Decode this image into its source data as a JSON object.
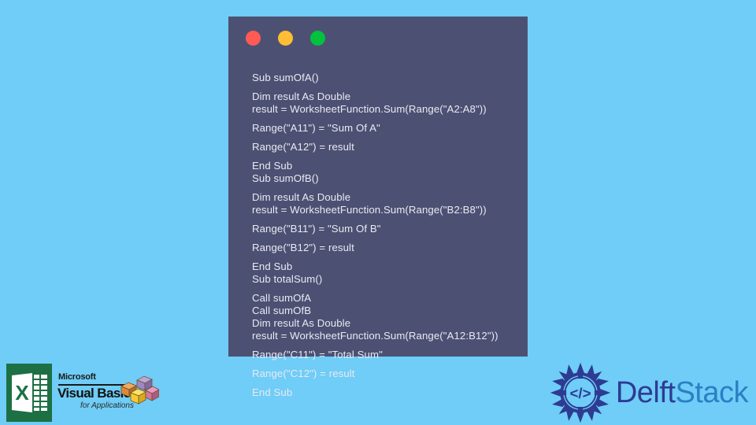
{
  "theme": {
    "page_background": "#6FCDF7",
    "code_panel_background": "#4C5173",
    "code_text_color": "#E9E9F2",
    "traffic_close": "#FF5A54",
    "traffic_minimize": "#FFBE33",
    "traffic_maximize": "#02C23E",
    "delft_color": "#2E3B92",
    "stack_color": "#2B7FC4",
    "excel_green": "#1D7044"
  },
  "window": {
    "controls": [
      {
        "name": "close",
        "color": "#FF5A54"
      },
      {
        "name": "minimize",
        "color": "#FFBE33"
      },
      {
        "name": "maximize",
        "color": "#02C23E"
      }
    ]
  },
  "code": {
    "language": "VBA",
    "lines": [
      {
        "text": "Sub sumOfA()",
        "gap_above": true
      },
      {
        "text": "Dim result As Double",
        "gap_above": true
      },
      {
        "text": "result = WorksheetFunction.Sum(Range(\"A2:A8\"))",
        "gap_above": false
      },
      {
        "text": "Range(\"A11\") = \"Sum Of A\"",
        "gap_above": true
      },
      {
        "text": "Range(\"A12\") = result",
        "gap_above": true
      },
      {
        "text": "End Sub",
        "gap_above": true
      },
      {
        "text": "Sub sumOfB()",
        "gap_above": false
      },
      {
        "text": "Dim result As Double",
        "gap_above": true
      },
      {
        "text": "result = WorksheetFunction.Sum(Range(\"B2:B8\"))",
        "gap_above": false
      },
      {
        "text": "Range(\"B11\") = \"Sum Of B\"",
        "gap_above": true
      },
      {
        "text": "Range(\"B12\") = result",
        "gap_above": true
      },
      {
        "text": "End Sub",
        "gap_above": true
      },
      {
        "text": "Sub totalSum()",
        "gap_above": false
      },
      {
        "text": "Call sumOfA",
        "gap_above": true
      },
      {
        "text": "Call sumOfB",
        "gap_above": false
      },
      {
        "text": "Dim result As Double",
        "gap_above": false
      },
      {
        "text": "result = WorksheetFunction.Sum(Range(\"A12:B12\"))",
        "gap_above": false
      },
      {
        "text": "Range(\"C11\") = \"Total Sum\"",
        "gap_above": true
      },
      {
        "text": "Range(\"C12\") = result",
        "gap_above": true
      },
      {
        "text": "End Sub",
        "gap_above": true
      }
    ]
  },
  "excel_logo": {
    "letter": "X"
  },
  "vba_logo": {
    "microsoft": "Microsoft",
    "title": "Visual Basic",
    "subtitle": "for Applications"
  },
  "delftstack": {
    "word_primary": "Delft",
    "word_secondary": "Stack",
    "emblem_symbol": "</>"
  }
}
